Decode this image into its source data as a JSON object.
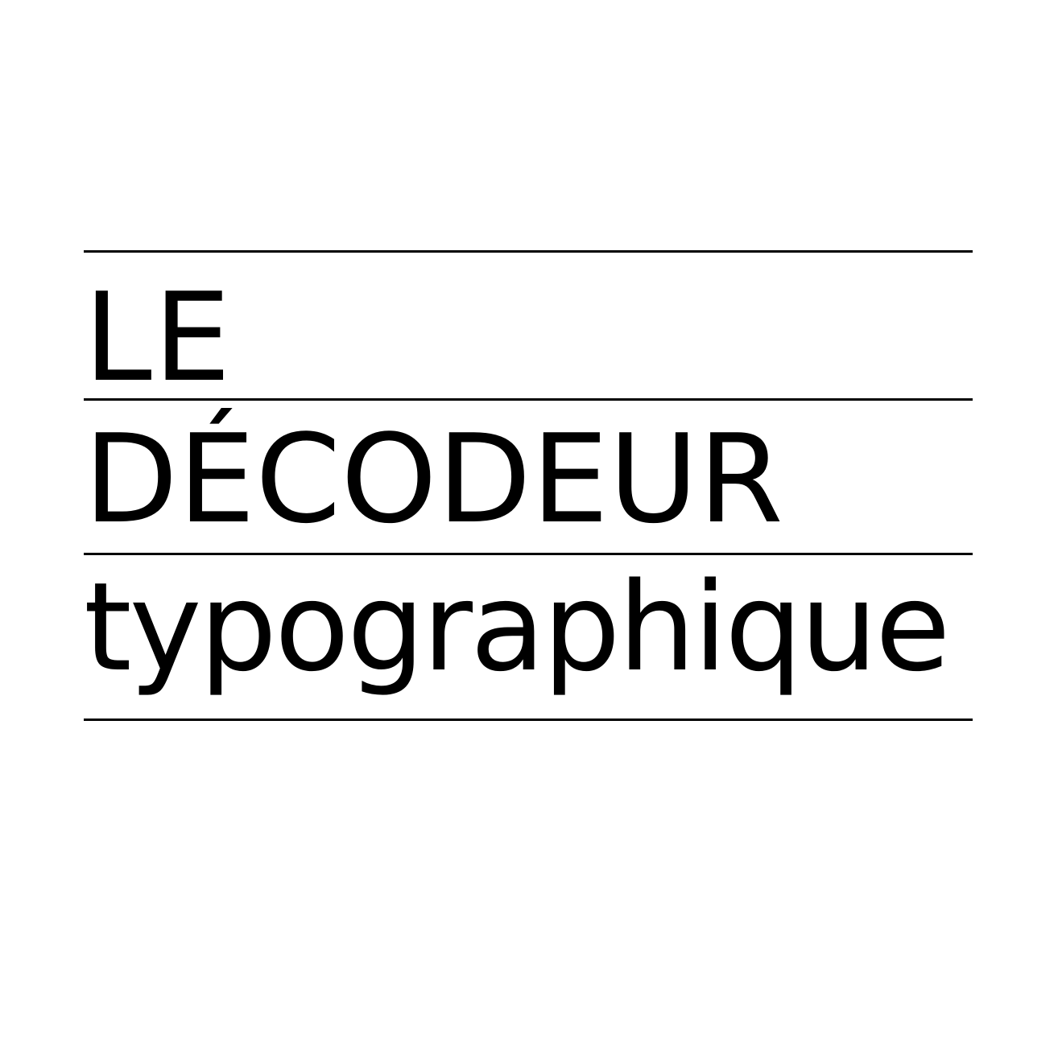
{
  "logo": {
    "line1": "LE",
    "line2": "DÉCODEUR",
    "line3": "typographique"
  },
  "colors": {
    "background": "#ffffff",
    "ink": "#000000"
  }
}
